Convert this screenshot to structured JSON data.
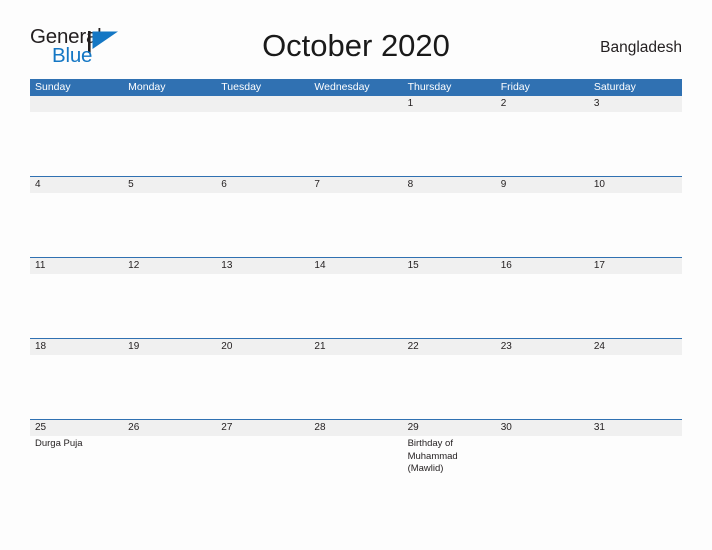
{
  "brand": {
    "name_part1": "General",
    "name_part2": "Blue",
    "flag_icon": "flag-icon",
    "accent_color": "#1477c4"
  },
  "header": {
    "title": "October 2020",
    "country": "Bangladesh"
  },
  "theme": {
    "header_blue": "#3071b2",
    "date_band_gray": "#f0f0f0",
    "page_background": "#fdfdfd",
    "text_color": "#231f20"
  },
  "calendar": {
    "month": "October",
    "year": "2020",
    "day_headers": [
      "Sunday",
      "Monday",
      "Tuesday",
      "Wednesday",
      "Thursday",
      "Friday",
      "Saturday"
    ],
    "weeks": [
      {
        "cells": [
          {
            "date": "",
            "event": ""
          },
          {
            "date": "",
            "event": ""
          },
          {
            "date": "",
            "event": ""
          },
          {
            "date": "",
            "event": ""
          },
          {
            "date": "1",
            "event": ""
          },
          {
            "date": "2",
            "event": ""
          },
          {
            "date": "3",
            "event": ""
          }
        ]
      },
      {
        "cells": [
          {
            "date": "4",
            "event": ""
          },
          {
            "date": "5",
            "event": ""
          },
          {
            "date": "6",
            "event": ""
          },
          {
            "date": "7",
            "event": ""
          },
          {
            "date": "8",
            "event": ""
          },
          {
            "date": "9",
            "event": ""
          },
          {
            "date": "10",
            "event": ""
          }
        ]
      },
      {
        "cells": [
          {
            "date": "11",
            "event": ""
          },
          {
            "date": "12",
            "event": ""
          },
          {
            "date": "13",
            "event": ""
          },
          {
            "date": "14",
            "event": ""
          },
          {
            "date": "15",
            "event": ""
          },
          {
            "date": "16",
            "event": ""
          },
          {
            "date": "17",
            "event": ""
          }
        ]
      },
      {
        "cells": [
          {
            "date": "18",
            "event": ""
          },
          {
            "date": "19",
            "event": ""
          },
          {
            "date": "20",
            "event": ""
          },
          {
            "date": "21",
            "event": ""
          },
          {
            "date": "22",
            "event": ""
          },
          {
            "date": "23",
            "event": ""
          },
          {
            "date": "24",
            "event": ""
          }
        ]
      },
      {
        "cells": [
          {
            "date": "25",
            "event": "Durga Puja"
          },
          {
            "date": "26",
            "event": ""
          },
          {
            "date": "27",
            "event": ""
          },
          {
            "date": "28",
            "event": ""
          },
          {
            "date": "29",
            "event": "Birthday of Muhammad (Mawlid)"
          },
          {
            "date": "30",
            "event": ""
          },
          {
            "date": "31",
            "event": ""
          }
        ]
      }
    ]
  }
}
